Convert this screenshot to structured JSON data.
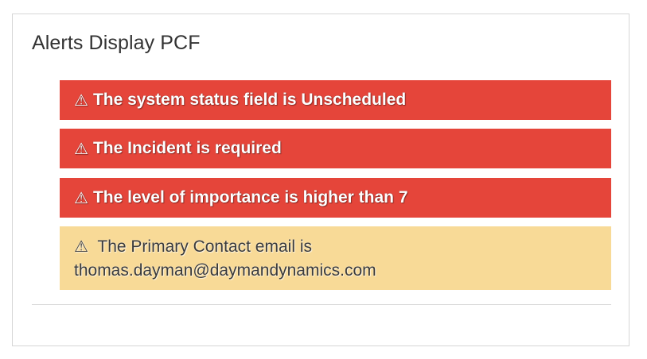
{
  "panel": {
    "title": "Alerts Display PCF"
  },
  "alerts": [
    {
      "type": "error",
      "icon": "warning-triangle-icon",
      "icon_glyph": "⚠",
      "text": "The system status field is Unscheduled",
      "color": "#e5453a"
    },
    {
      "type": "error",
      "icon": "warning-triangle-icon",
      "icon_glyph": "⚠",
      "text": "The Incident is required",
      "color": "#e5453a"
    },
    {
      "type": "error",
      "icon": "warning-triangle-icon",
      "icon_glyph": "⚠",
      "text": "The level of importance is higher than 7",
      "color": "#e5453a"
    },
    {
      "type": "warning",
      "icon": "warning-triangle-icon",
      "icon_glyph": "⚠",
      "text": "The Primary Contact email is thomas.dayman@daymandynamics.com",
      "color": "#f8da97"
    }
  ]
}
